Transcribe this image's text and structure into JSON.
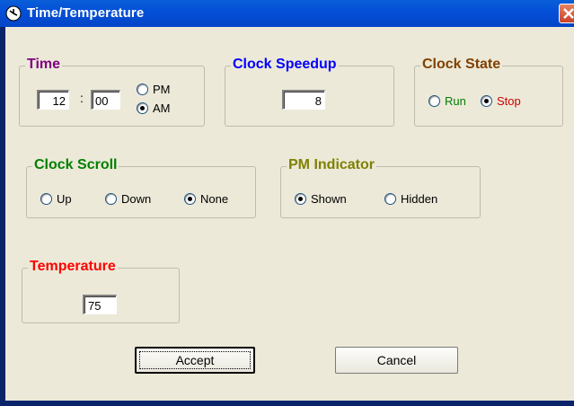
{
  "window": {
    "title": "Time/Temperature",
    "title_icon": "clock-icon"
  },
  "time_group": {
    "title": "Time",
    "title_color": "#800080",
    "hour": "12",
    "separator": ":",
    "minute": "00",
    "pm_label": "PM",
    "am_label": "AM",
    "selected": "AM"
  },
  "speedup_group": {
    "title": "Clock Speedup",
    "title_color": "#0000ff",
    "value": "8"
  },
  "state_group": {
    "title": "Clock State",
    "title_color": "#804000",
    "run_label": "Run",
    "run_color": "#008000",
    "stop_label": "Stop",
    "stop_color": "#cc0000",
    "selected": "Stop"
  },
  "scroll_group": {
    "title": "Clock Scroll",
    "title_color": "#008000",
    "up_label": "Up",
    "down_label": "Down",
    "none_label": "None",
    "selected": "None"
  },
  "pm_indicator_group": {
    "title": "PM Indicator",
    "title_color": "#808000",
    "shown_label": "Shown",
    "hidden_label": "Hidden",
    "selected": "Shown"
  },
  "temperature_group": {
    "title": "Temperature",
    "title_color": "#ff0000",
    "value": "75"
  },
  "buttons": {
    "accept_label": "Accept",
    "cancel_label": "Cancel"
  }
}
